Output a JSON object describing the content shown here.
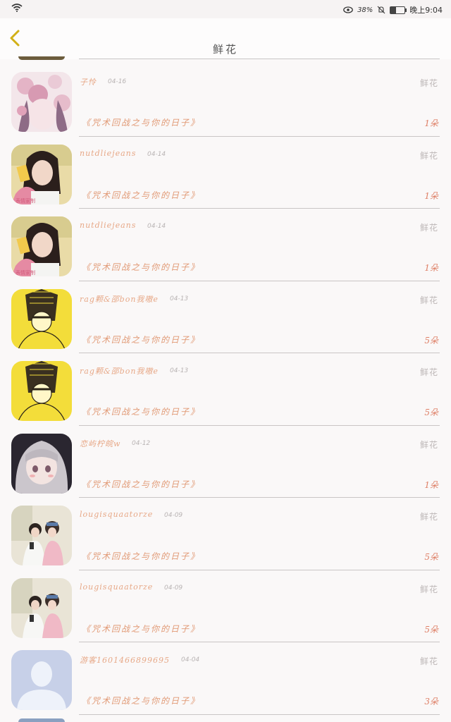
{
  "status_bar": {
    "battery": "38%",
    "time": "晚上9:04"
  },
  "header": {
    "title": "鲜花"
  },
  "rows": [
    {
      "name": "子怜",
      "date": "04-16",
      "type": "鲜花",
      "book": "《咒术回战之与你的日子》",
      "count": "1朵",
      "avatar": "anime-pink-flowers"
    },
    {
      "name": "nutdliejeans",
      "date": "04-14",
      "type": "鲜花",
      "book": "《咒术回战之与你的日子》",
      "count": "1朵",
      "avatar": "girl-selfie"
    },
    {
      "name": "nutdliejeans",
      "date": "04-14",
      "type": "鲜花",
      "book": "《咒术回战之与你的日子》",
      "count": "1朵",
      "avatar": "girl-selfie"
    },
    {
      "name": "rag颗&邵bon我嗷e",
      "date": "04-13",
      "type": "鲜花",
      "book": "《咒术回战之与你的日子》",
      "count": "5朵",
      "avatar": "yellow-sketch"
    },
    {
      "name": "rag颗&邵bon我嗷e",
      "date": "04-13",
      "type": "鲜花",
      "book": "《咒术回战之与你的日子》",
      "count": "5朵",
      "avatar": "yellow-sketch"
    },
    {
      "name": "恋屿柠皖w",
      "date": "04-12",
      "type": "鲜花",
      "book": "《咒术回战之与你的日子》",
      "count": "1朵",
      "avatar": "anime-silver-hair"
    },
    {
      "name": "lougisquaatorze",
      "date": "04-09",
      "type": "鲜花",
      "book": "《咒术回战之与你的日子》",
      "count": "5朵",
      "avatar": "couple-photo"
    },
    {
      "name": "lougisquaatorze",
      "date": "04-09",
      "type": "鲜花",
      "book": "《咒术回战之与你的日子》",
      "count": "5朵",
      "avatar": "couple-photo"
    },
    {
      "name": "游客1601466899695",
      "date": "04-04",
      "type": "鲜花",
      "book": "《咒术回战之与你的日子》",
      "count": "3朵",
      "avatar": "default-user"
    }
  ]
}
